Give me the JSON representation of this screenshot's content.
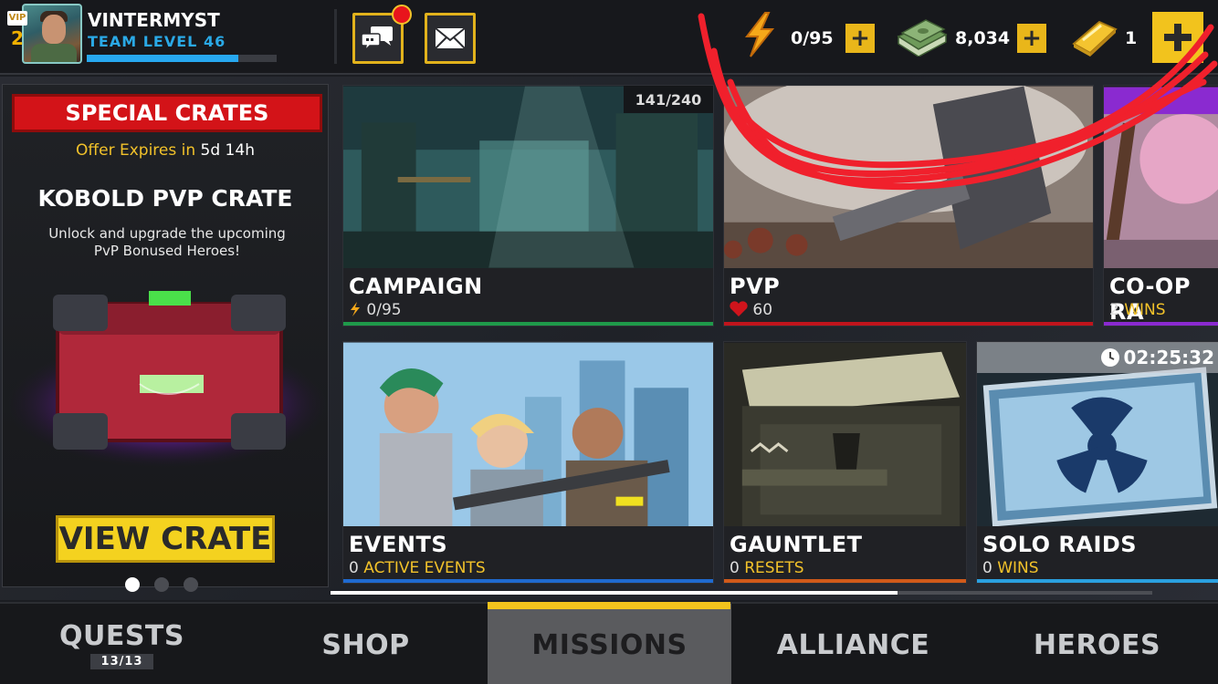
{
  "player": {
    "vip_label": "VIP",
    "vip_level": "2",
    "name": "VINTERMYST",
    "team_level_label": "TEAM LEVEL",
    "team_level": "46",
    "xp_fraction": 0.8
  },
  "resources": {
    "energy": "0/95",
    "cash": "8,034",
    "gold": "1",
    "plus": "+"
  },
  "special_offer": {
    "banner": "SPECIAL CRATES",
    "expires_label": "Offer Expires in",
    "expires_value": "5d 14h",
    "title": "KOBOLD PVP CRATE",
    "description": "Unlock and upgrade the upcoming PvP Bonused Heroes!",
    "button": "VIEW CRATE",
    "active_page": 1,
    "pages": 3
  },
  "modes": {
    "campaign": {
      "title": "CAMPAIGN",
      "progress": "141/240",
      "sub_value": "0/95",
      "stripe_color": "#1f9a4a"
    },
    "pvp": {
      "title": "PVP",
      "sub_value": "60",
      "stripe_color": "#c0141c"
    },
    "coop": {
      "title": "CO-OP RA",
      "sub_count": "2",
      "sub_label": "WINS",
      "stripe_color": "#8a2ad0"
    },
    "events": {
      "title": "EVENTS",
      "sub_count": "0",
      "sub_label": "ACTIVE EVENTS",
      "stripe_color": "#1f6ad0"
    },
    "gauntlet": {
      "title": "GAUNTLET",
      "sub_count": "0",
      "sub_label": "RESETS",
      "stripe_color": "#d05a1a"
    },
    "solo": {
      "title": "SOLO RAIDS",
      "sub_count": "0",
      "sub_label": "WINS",
      "timer": "02:25:32",
      "stripe_color": "#2aa0e0"
    }
  },
  "scroll": {
    "position_fraction": 0.69
  },
  "nav": {
    "quests": "QUESTS",
    "quests_count": "13/13",
    "shop": "SHOP",
    "missions": "MISSIONS",
    "alliance": "ALLIANCE",
    "heroes": "HEROES",
    "active": "missions"
  },
  "colors": {
    "accent_gold": "#f2c31d",
    "sub_label_yellow": "#f2c22a",
    "level_blue": "#2aa9e6",
    "scribble_red": "#f0202c"
  }
}
